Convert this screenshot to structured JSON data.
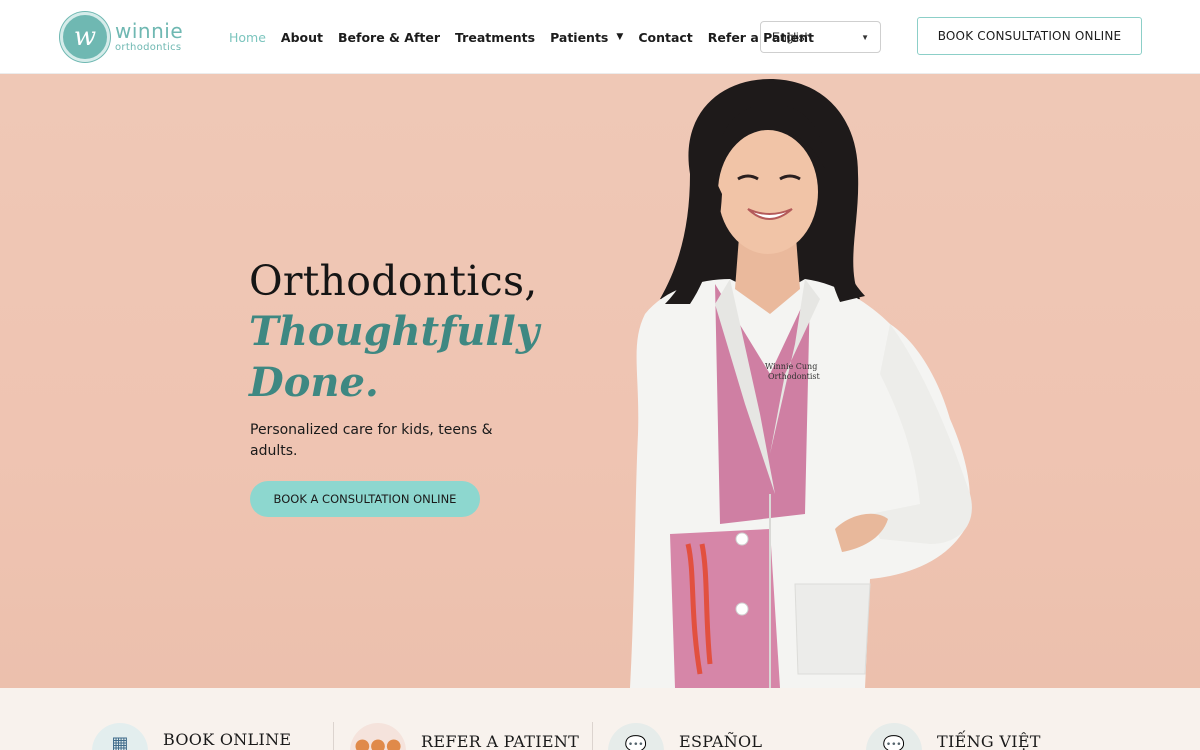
{
  "brand": {
    "mark": "w",
    "name": "winnie",
    "tagline": "orthodontics",
    "accent_color": "#6fb8b2"
  },
  "nav": {
    "items": [
      {
        "label": "Home",
        "active": true
      },
      {
        "label": "About"
      },
      {
        "label": "Before & After"
      },
      {
        "label": "Treatments"
      },
      {
        "label": "Patients",
        "has_dropdown": true
      },
      {
        "label": "Contact"
      },
      {
        "label": "Refer a Patient"
      }
    ]
  },
  "language": {
    "selected": "English"
  },
  "header_cta": {
    "label": "BOOK CONSULTATION ONLINE"
  },
  "hero": {
    "title_line1": "Orthodontics,",
    "title_line2": "Thoughtfully",
    "title_line3": "Done.",
    "subtitle": "Personalized care for kids, teens & adults.",
    "button": "BOOK A CONSULTATION ONLINE",
    "coat_text_line1": "Winnie Cung",
    "coat_text_line2": "Orthodontist",
    "background_color": "#efc6b4",
    "button_color": "#8dd7cf"
  },
  "quick_links": [
    {
      "label": "BOOK ONLINE",
      "icon": "calendar-icon"
    },
    {
      "label": "REFER A PATIENT",
      "icon": "people-icon"
    },
    {
      "label": "ESPAÑOL",
      "icon": "chat-bubbles-icon"
    },
    {
      "label": "TIẾNG VIỆT",
      "icon": "chat-bubbles-icon"
    }
  ]
}
